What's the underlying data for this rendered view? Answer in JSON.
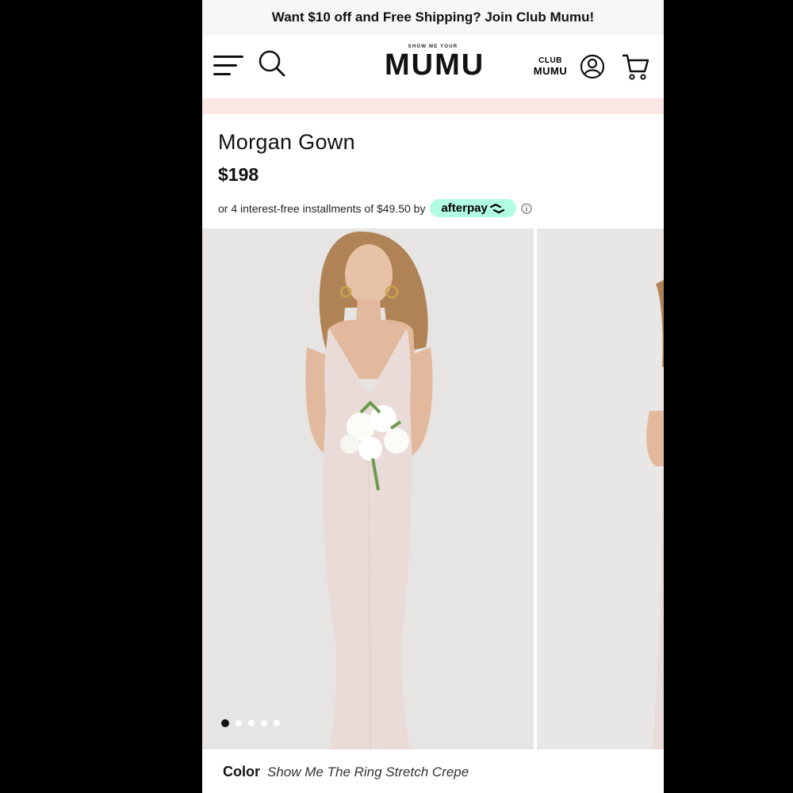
{
  "promo_banner": {
    "text": "Want $10 off and Free Shipping? Join Club Mumu!"
  },
  "header": {
    "logo_small": "SHOW ME YOUR",
    "logo_big": "MUMU",
    "club_line1": "CLUB",
    "club_line2": "MUMU",
    "icons": [
      "menu-icon",
      "search-icon",
      "account-icon",
      "cart-icon"
    ]
  },
  "product": {
    "title": "Morgan Gown",
    "price": "$198",
    "installment_text": "or 4 interest-free installments of $49.50 by",
    "afterpay_label": "afterpay"
  },
  "gallery": {
    "dot_count": 5,
    "active_dot": 1
  },
  "color": {
    "label": "Color",
    "value": "Show Me The Ring Stretch Crepe"
  },
  "colors": {
    "afterpay_bg": "#b2fce4",
    "pink_band": "#fbe8e6",
    "dress": "#e9dcd8"
  }
}
